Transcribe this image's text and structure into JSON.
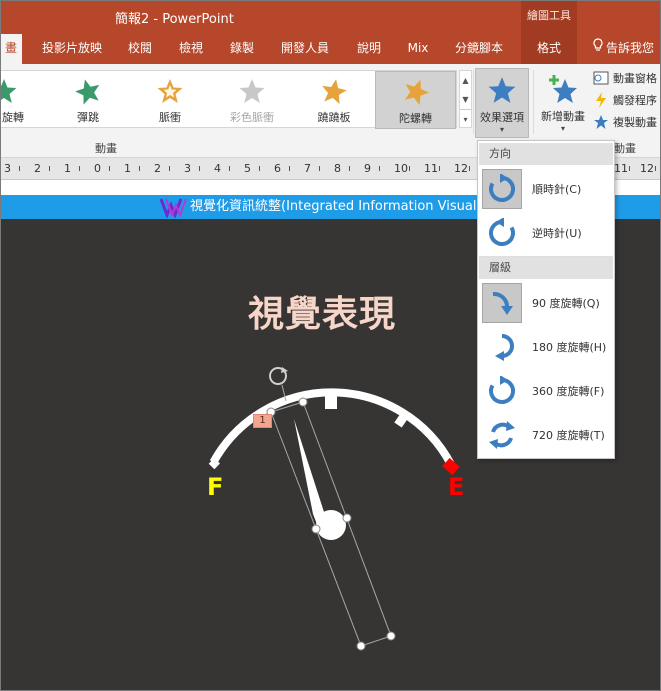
{
  "window": {
    "title": "簡報2 - PowerPoint",
    "context_group": "繪圖工具"
  },
  "tabs": [
    {
      "label": "畫",
      "active": true
    },
    {
      "label": "投影片放映"
    },
    {
      "label": "校閱"
    },
    {
      "label": "檢視"
    },
    {
      "label": "錄製"
    },
    {
      "label": "開發人員"
    },
    {
      "label": "說明"
    },
    {
      "label": "Mix"
    },
    {
      "label": "分鏡腳本"
    },
    {
      "label": "格式",
      "context": true
    },
    {
      "label": "告訴我您"
    }
  ],
  "ribbon": {
    "group_label": "動畫",
    "group_label_2": "動畫",
    "animations": [
      {
        "label": "旋轉",
        "color": "#3a9a6c",
        "icon": "spin-star-icon"
      },
      {
        "label": "彈跳",
        "color": "#3a9a6c",
        "icon": "bounce-star-icon"
      },
      {
        "label": "脈衝",
        "color": "#e6a33c",
        "icon": "pulse-star-icon"
      },
      {
        "label": "彩色脈衝",
        "color": "#c8c8c8",
        "icon": "color-pulse-star-icon",
        "disabled": true
      },
      {
        "label": "蹺蹺板",
        "color": "#e6a33c",
        "icon": "teeter-star-icon"
      },
      {
        "label": "陀螺轉",
        "color": "#e6a33c",
        "icon": "spin-top-star-icon",
        "selected": true
      }
    ],
    "effect_options": {
      "label": "效果選項"
    },
    "add_animation": {
      "label": "新增動畫"
    },
    "advanced": [
      {
        "label": "動畫窗格",
        "icon": "animation-pane-icon"
      },
      {
        "label": "觸發程序",
        "icon": "trigger-icon"
      },
      {
        "label": "複製動畫",
        "icon": "animation-painter-icon"
      }
    ]
  },
  "ruler": {
    "ticks": [
      "3",
      "2",
      "1",
      "0",
      "1",
      "2",
      "3",
      "4",
      "5",
      "6",
      "7",
      "8",
      "9",
      "10",
      "11",
      "12"
    ],
    "right_ticks": [
      "11",
      "12"
    ]
  },
  "banner": {
    "text": "視覺化資訊統整(Integrated Information Visualization)"
  },
  "slide": {
    "title": "視覺表現",
    "gauge": {
      "fill_label": "F",
      "empty_label": "E",
      "full_color": "#ffff00",
      "empty_color": "#ff0000",
      "animation_tag": "1"
    }
  },
  "dropdown": {
    "direction_header": "方向",
    "amount_header": "層級",
    "direction_items": [
      {
        "label": "順時針(C)",
        "checked": true,
        "icon": "clockwise-icon"
      },
      {
        "label": "逆時針(U)",
        "icon": "counterclockwise-icon"
      }
    ],
    "amount_items": [
      {
        "label": "90 度旋轉(Q)",
        "checked": true,
        "icon": "quarter-spin-icon"
      },
      {
        "label": "180 度旋轉(H)",
        "icon": "half-spin-icon"
      },
      {
        "label": "360 度旋轉(F)",
        "icon": "full-spin-icon"
      },
      {
        "label": "720 度旋轉(T)",
        "icon": "two-spins-icon"
      }
    ]
  },
  "colors": {
    "accent": "#b7472a",
    "icon_blue": "#3c7ec0",
    "slide_bg": "#373534",
    "banner": "#1f9ce8"
  }
}
